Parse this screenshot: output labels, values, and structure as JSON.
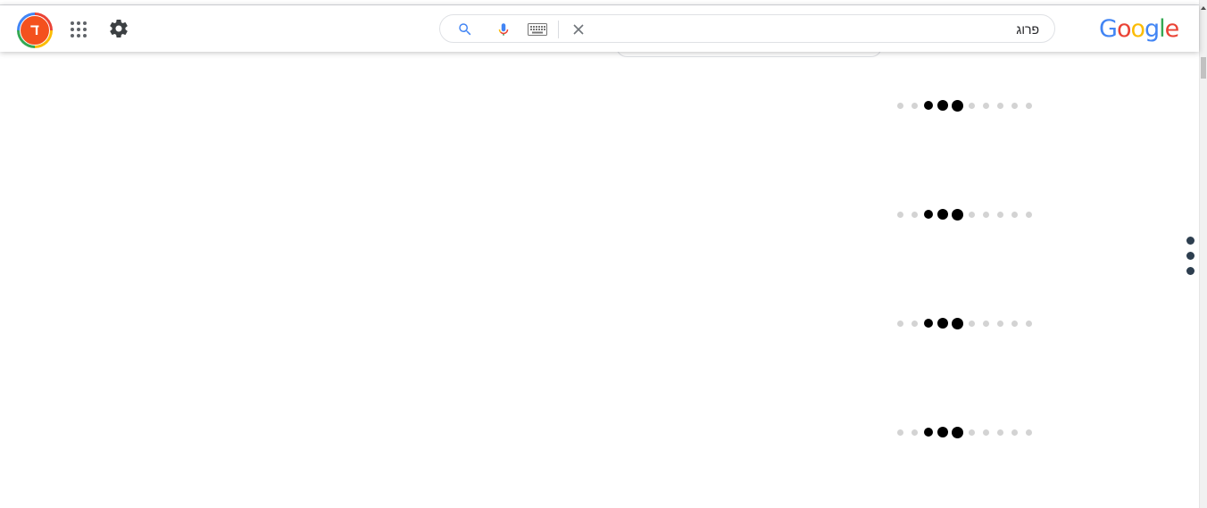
{
  "header": {
    "avatar_initial": "ד",
    "search": {
      "query": "פרוג",
      "placeholder": ""
    },
    "logo": {
      "letters": [
        {
          "ch": "G",
          "color": "#4285f4"
        },
        {
          "ch": "o",
          "color": "#ea4335"
        },
        {
          "ch": "o",
          "color": "#fbbc05"
        },
        {
          "ch": "g",
          "color": "#4285f4"
        },
        {
          "ch": "l",
          "color": "#34a853"
        },
        {
          "ch": "e",
          "color": "#ea4335"
        }
      ]
    },
    "icons": {
      "apps": "apps-grid-icon",
      "settings": "gear-icon",
      "search": "search-icon",
      "mic": "microphone-icon",
      "keyboard": "keyboard-icon",
      "clear": "close-icon"
    }
  },
  "loaders": {
    "count": 4,
    "dots_per_loader": 10,
    "active_dots": [
      2,
      3,
      4
    ],
    "active_color": "#000000",
    "inactive_color": "#d3d3d3"
  },
  "side_menu": {
    "icon": "vertical-dots-icon"
  },
  "colors": {
    "accent_blue": "#4285f4",
    "avatar_bg": "#f4511e"
  }
}
